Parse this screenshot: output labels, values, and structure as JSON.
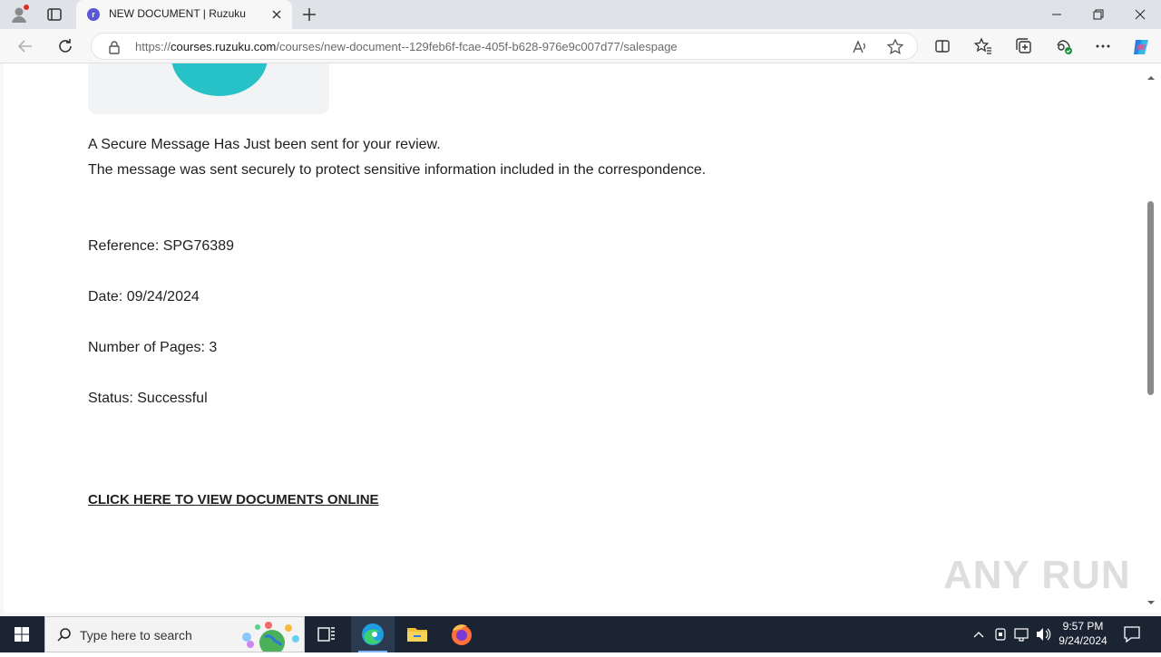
{
  "browser": {
    "tab_title": "NEW DOCUMENT | Ruzuku",
    "favicon_letter": "r",
    "url_prefix": "https://",
    "url_host": "courses.ruzuku.com",
    "url_path": "/courses/new-document--129feb6f-fcae-405f-b628-976e9c007d77/salespage"
  },
  "page": {
    "line1": "A Secure Message Has Just been sent for your review.",
    "line2": "The message was sent securely to protect sensitive information included in the correspondence.",
    "reference": "Reference: SPG76389",
    "date": "Date: 09/24/2024",
    "pages": "Number of Pages: 3",
    "status": "Status: Successful",
    "cta": "CLICK HERE TO VIEW DOCUMENTS ONLINE"
  },
  "watermark": "ANY RUN",
  "taskbar": {
    "search_placeholder": "Type here to search",
    "time": "9:57 PM",
    "date": "9/24/2024"
  },
  "colors": {
    "accent_blue": "#0078d4",
    "hero_teal": "#27c2c8",
    "taskbar_bg": "#1b2433"
  }
}
